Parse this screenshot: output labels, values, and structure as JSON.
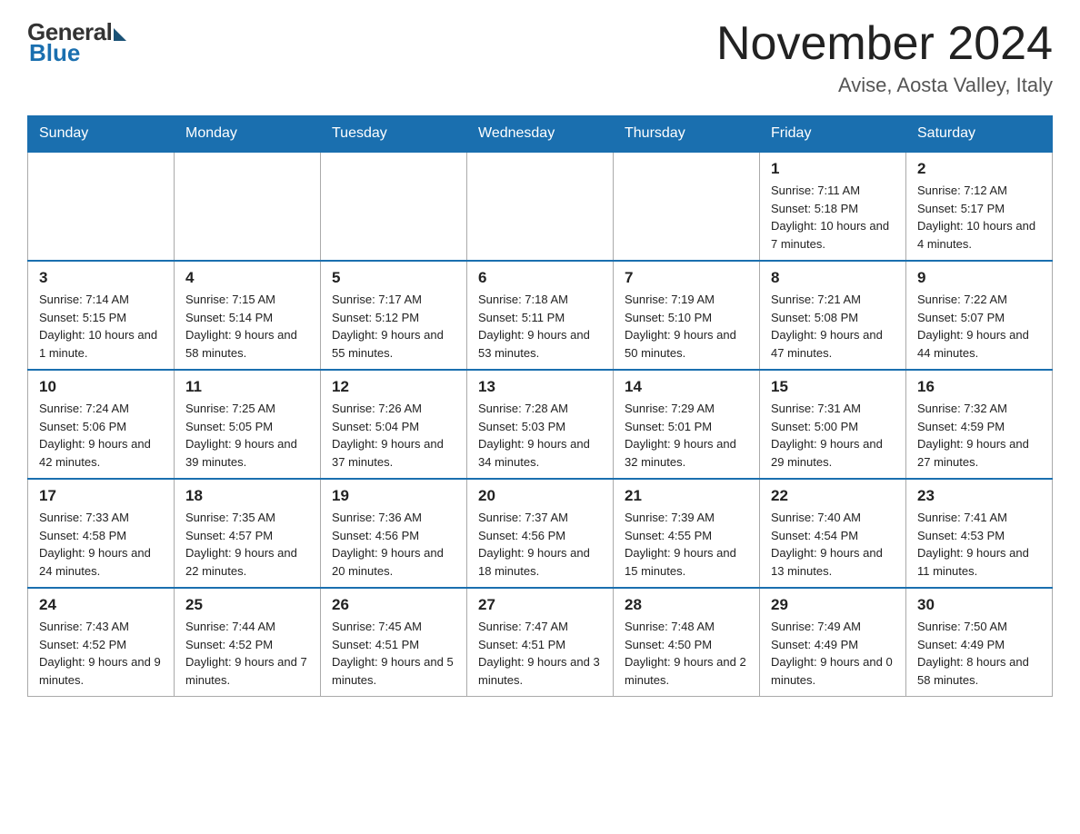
{
  "header": {
    "logo_general": "General",
    "logo_blue": "Blue",
    "month_title": "November 2024",
    "location": "Avise, Aosta Valley, Italy"
  },
  "days_of_week": [
    "Sunday",
    "Monday",
    "Tuesday",
    "Wednesday",
    "Thursday",
    "Friday",
    "Saturday"
  ],
  "weeks": [
    [
      {
        "day": "",
        "info": ""
      },
      {
        "day": "",
        "info": ""
      },
      {
        "day": "",
        "info": ""
      },
      {
        "day": "",
        "info": ""
      },
      {
        "day": "",
        "info": ""
      },
      {
        "day": "1",
        "info": "Sunrise: 7:11 AM\nSunset: 5:18 PM\nDaylight: 10 hours and 7 minutes."
      },
      {
        "day": "2",
        "info": "Sunrise: 7:12 AM\nSunset: 5:17 PM\nDaylight: 10 hours and 4 minutes."
      }
    ],
    [
      {
        "day": "3",
        "info": "Sunrise: 7:14 AM\nSunset: 5:15 PM\nDaylight: 10 hours and 1 minute."
      },
      {
        "day": "4",
        "info": "Sunrise: 7:15 AM\nSunset: 5:14 PM\nDaylight: 9 hours and 58 minutes."
      },
      {
        "day": "5",
        "info": "Sunrise: 7:17 AM\nSunset: 5:12 PM\nDaylight: 9 hours and 55 minutes."
      },
      {
        "day": "6",
        "info": "Sunrise: 7:18 AM\nSunset: 5:11 PM\nDaylight: 9 hours and 53 minutes."
      },
      {
        "day": "7",
        "info": "Sunrise: 7:19 AM\nSunset: 5:10 PM\nDaylight: 9 hours and 50 minutes."
      },
      {
        "day": "8",
        "info": "Sunrise: 7:21 AM\nSunset: 5:08 PM\nDaylight: 9 hours and 47 minutes."
      },
      {
        "day": "9",
        "info": "Sunrise: 7:22 AM\nSunset: 5:07 PM\nDaylight: 9 hours and 44 minutes."
      }
    ],
    [
      {
        "day": "10",
        "info": "Sunrise: 7:24 AM\nSunset: 5:06 PM\nDaylight: 9 hours and 42 minutes."
      },
      {
        "day": "11",
        "info": "Sunrise: 7:25 AM\nSunset: 5:05 PM\nDaylight: 9 hours and 39 minutes."
      },
      {
        "day": "12",
        "info": "Sunrise: 7:26 AM\nSunset: 5:04 PM\nDaylight: 9 hours and 37 minutes."
      },
      {
        "day": "13",
        "info": "Sunrise: 7:28 AM\nSunset: 5:03 PM\nDaylight: 9 hours and 34 minutes."
      },
      {
        "day": "14",
        "info": "Sunrise: 7:29 AM\nSunset: 5:01 PM\nDaylight: 9 hours and 32 minutes."
      },
      {
        "day": "15",
        "info": "Sunrise: 7:31 AM\nSunset: 5:00 PM\nDaylight: 9 hours and 29 minutes."
      },
      {
        "day": "16",
        "info": "Sunrise: 7:32 AM\nSunset: 4:59 PM\nDaylight: 9 hours and 27 minutes."
      }
    ],
    [
      {
        "day": "17",
        "info": "Sunrise: 7:33 AM\nSunset: 4:58 PM\nDaylight: 9 hours and 24 minutes."
      },
      {
        "day": "18",
        "info": "Sunrise: 7:35 AM\nSunset: 4:57 PM\nDaylight: 9 hours and 22 minutes."
      },
      {
        "day": "19",
        "info": "Sunrise: 7:36 AM\nSunset: 4:56 PM\nDaylight: 9 hours and 20 minutes."
      },
      {
        "day": "20",
        "info": "Sunrise: 7:37 AM\nSunset: 4:56 PM\nDaylight: 9 hours and 18 minutes."
      },
      {
        "day": "21",
        "info": "Sunrise: 7:39 AM\nSunset: 4:55 PM\nDaylight: 9 hours and 15 minutes."
      },
      {
        "day": "22",
        "info": "Sunrise: 7:40 AM\nSunset: 4:54 PM\nDaylight: 9 hours and 13 minutes."
      },
      {
        "day": "23",
        "info": "Sunrise: 7:41 AM\nSunset: 4:53 PM\nDaylight: 9 hours and 11 minutes."
      }
    ],
    [
      {
        "day": "24",
        "info": "Sunrise: 7:43 AM\nSunset: 4:52 PM\nDaylight: 9 hours and 9 minutes."
      },
      {
        "day": "25",
        "info": "Sunrise: 7:44 AM\nSunset: 4:52 PM\nDaylight: 9 hours and 7 minutes."
      },
      {
        "day": "26",
        "info": "Sunrise: 7:45 AM\nSunset: 4:51 PM\nDaylight: 9 hours and 5 minutes."
      },
      {
        "day": "27",
        "info": "Sunrise: 7:47 AM\nSunset: 4:51 PM\nDaylight: 9 hours and 3 minutes."
      },
      {
        "day": "28",
        "info": "Sunrise: 7:48 AM\nSunset: 4:50 PM\nDaylight: 9 hours and 2 minutes."
      },
      {
        "day": "29",
        "info": "Sunrise: 7:49 AM\nSunset: 4:49 PM\nDaylight: 9 hours and 0 minutes."
      },
      {
        "day": "30",
        "info": "Sunrise: 7:50 AM\nSunset: 4:49 PM\nDaylight: 8 hours and 58 minutes."
      }
    ]
  ]
}
